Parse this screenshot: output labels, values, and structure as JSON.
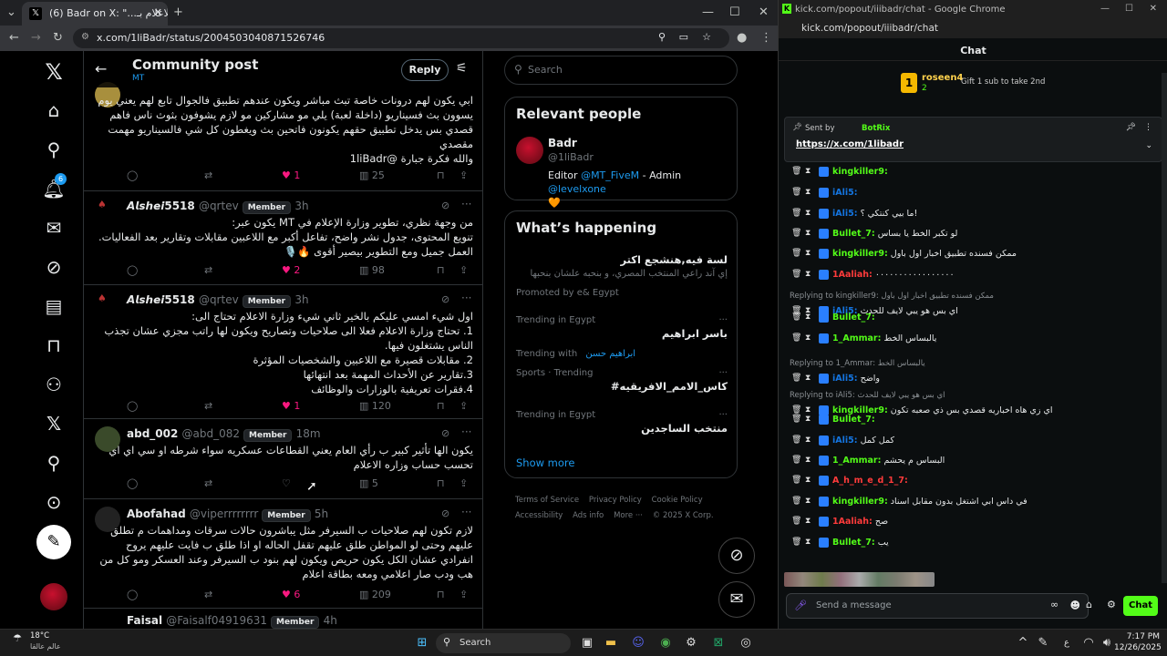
{
  "x_window": {
    "tab_title": "(6) Badr on X: \"...وزارة الاعلام بـ",
    "url": "x.com/1liBadr/status/2004503040871526746",
    "header": {
      "title": "Community post",
      "subtitle": "MT",
      "reply_label": "Reply"
    },
    "posts": [
      {
        "name": "",
        "handle": "",
        "member": "Member",
        "time": "",
        "lines": [
          "ابي يكون لهم درونات خاصة تبث مباشر ويكون عندهم تطبيق فالجوال تابع لهم يعني يوم",
          "يسوون بث فسيناريو (داخلة لعبة) يلي مو مشاركين مو لازم يشوفون بثوث ناس فاهم",
          "قصدي بس يدخل تطبيق حقهم يكونون فاتحين بث ويغطون كل شي فالسيناريو مهمت",
          "مقصدي",
          "والله فكرة جبارة @1liBadr"
        ],
        "replies": "",
        "reposts": "",
        "likes": "1",
        "views": "25"
      },
      {
        "name": "𝘼𝙡𝙨𝙝𝙚𝙞5518",
        "handle": "@qrtev",
        "member": "Member",
        "time": "3h",
        "lines": [
          "من وجهة نظري، تطوير وزارة الإعلام في MT يكون عبر:",
          "تنويع المحتوى، جدول نشر واضح، تفاعل أكبر مع اللاعبين مقابلات وتقارير بعد الفعاليات.",
          "العمل جميل ومع التطوير بيصير أقوى 🔥🎙️"
        ],
        "likes": "2",
        "views": "98"
      },
      {
        "name": "𝘼𝙡𝙨𝙝𝙚𝙞5518",
        "handle": "@qrtev",
        "member": "Member",
        "time": "3h",
        "lines": [
          "اول شيء امسي عليكم بالخير ثاني شيء وزارة الاعلام تحتاج الى:",
          "1. تحتاج وزارة الاعلام فعلا الى صلاحيات وتصاريح ويكون لها راتب مجزي عشان تجذب",
          "الناس يشتغلون فيها.",
          "2. مقابلات قصيرة مع اللاعبين والشخصيات المؤثرة",
          "3.تقارير عن الأحداث المهمة بعد انتهائها",
          "4.فقرات تعريفية بالوزارات والوظائف"
        ],
        "likes": "1",
        "views": "120"
      },
      {
        "name": "abd_002",
        "handle": "@abd_082",
        "member": "Member",
        "time": "18m",
        "lines": [
          "يكون الها تأثير كبير ب رأي العام يعني القطاعات عسكريه سواء شرطه او سي اي اي",
          "تحسب حساب وزاره الاعلام"
        ],
        "likes": "",
        "views": "5"
      },
      {
        "name": "Abofahad",
        "handle": "@viperrrrrrrr",
        "member": "Member",
        "time": "5h",
        "lines": [
          "لازم تكون لهم صلاحيات ب السيرفر مثل يباشرون حالات سرقات ومداهمات م تطلق",
          "عليهم وحتى لو المواطن طلق عليهم تقفل الحاله او اذا طلق ب فايت عليهم يروح",
          "انفرادي عشان الكل يكون حريص ويكون لهم بنود ب السيرفر وعند العسكر ومو كل من",
          "هب ودب صار اعلامي ومعه بطاقة اعلام"
        ],
        "likes": "6",
        "views": "209"
      },
      {
        "name": "Faisal",
        "handle": "@Faisalf04919631",
        "member": "Member",
        "time": "4h",
        "lines": []
      }
    ],
    "sidebar": {
      "search_placeholder": "Search",
      "relevant_title": "Relevant people",
      "person": {
        "name": "Badr",
        "handle": "@1liBadr",
        "bio_prefix": "Editor ",
        "bio_link1": "@MT_FiveM",
        "bio_mid": " - Admin ",
        "bio_link2": "@levelxone",
        "bio_emoji": "🧡"
      },
      "happening_title": "What’s happening",
      "promo": {
        "title": "لسة فيه,هنشجع اكتر",
        "sub": "إي آند راعي المنتخب المصري، و بنحبه علشان بنحبها",
        "promoted": "Promoted by e& Egypt"
      },
      "trends": [
        {
          "context": "Trending in Egypt",
          "name": "باسر ابراهيم",
          "extra": ""
        },
        {
          "context": "Trending with",
          "name": "",
          "extra": "ابراهيم حسن"
        },
        {
          "context": "Sports · Trending",
          "name": "#كاس_الامم_الافريقيه",
          "extra": ""
        },
        {
          "context": "Trending in Egypt",
          "name": "منتخب الساجدين",
          "extra": ""
        }
      ],
      "show_more": "Show more",
      "footer": [
        "Terms of Service",
        "Privacy Policy",
        "Cookie Policy",
        "Accessibility",
        "Ads info",
        "More ···",
        "© 2025 X Corp."
      ]
    }
  },
  "kick_window": {
    "title": "kick.com/popout/iiibadr/chat - Google Chrome",
    "url": "kick.com/popout/iiibadr/chat",
    "chat_label": "Chat",
    "top_gifter": {
      "name": "roseen4",
      "count": "2",
      "gift_text": "Gift 1 sub to take 2nd"
    },
    "pinned": {
      "sent_by": "Sent by",
      "bot": "BotRix",
      "link": "https://x.com/1libadr"
    },
    "rows": [
      {
        "user": "kingkiller9:",
        "color": "#53fc18",
        "text": ""
      },
      {
        "user": "iAli5:",
        "color": "#1475e1",
        "text": ""
      },
      {
        "user": "iAli5:",
        "color": "#1475e1",
        "text": "ما بيي كنتكي ؟!"
      },
      {
        "user": "Bullet_7:",
        "color": "#53fc18",
        "text": "لو تكبر الخط يا بساس"
      },
      {
        "user": "kingkiller9:",
        "color": "#53fc18",
        "text": "ممكن فسنده تطبيق اخبار اول باول"
      },
      {
        "user": "1Aaliah:",
        "color": "#ff3b3b",
        "text": "٠٠٠٠٠٠٠٠٠٠٠٠٠٠٠٠٠"
      },
      {
        "user": "iAli5:",
        "color": "#1475e1",
        "text": "اي بس هو يبي لايف للحدث",
        "reply": "Replying to kingkiller9: ممكن فسنده تطبيق اخبار اول باول"
      },
      {
        "user": "Bullet_7:",
        "color": "#53fc18",
        "text": ""
      },
      {
        "user": "1_Ammar:",
        "color": "#53fc18",
        "text": "يالبساس الخط"
      },
      {
        "user": "iAli5:",
        "color": "#1475e1",
        "text": "واضح",
        "reply": "Replying to 1_Ammar: يالبساس الخط"
      },
      {
        "user": "kingkiller9:",
        "color": "#53fc18",
        "text": "اي زي هاه اخباريه قصدي بس ذي صعبه تكون",
        "reply": "Replying to iAli5: اي بس هو يبي لايف للحدث"
      },
      {
        "user": "Bullet_7:",
        "color": "#53fc18",
        "text": ""
      },
      {
        "user": "iAli5:",
        "color": "#1475e1",
        "text": "كمل كمل"
      },
      {
        "user": "1_Ammar:",
        "color": "#53fc18",
        "text": "البساس م يحشم"
      },
      {
        "user": "A_h_m_e_d_1_7:",
        "color": "#ff3b3b",
        "text": ""
      },
      {
        "user": "kingkiller9:",
        "color": "#53fc18",
        "text": "في داس ابي اشتغل بدون مقابل اسناد"
      },
      {
        "user": "1Aaliah:",
        "color": "#ff3b3b",
        "text": "صح"
      },
      {
        "user": "Bullet_7:",
        "color": "#53fc18",
        "text": "يب"
      }
    ],
    "send_placeholder": "Send a message",
    "chat_button": "Chat",
    "infinity": "∞"
  },
  "taskbar": {
    "weather_temp": "18°C",
    "weather_label": "عالم عالقا",
    "search": "Search",
    "lang": "ع",
    "time": "7:17 PM",
    "date": "12/26/2025"
  }
}
